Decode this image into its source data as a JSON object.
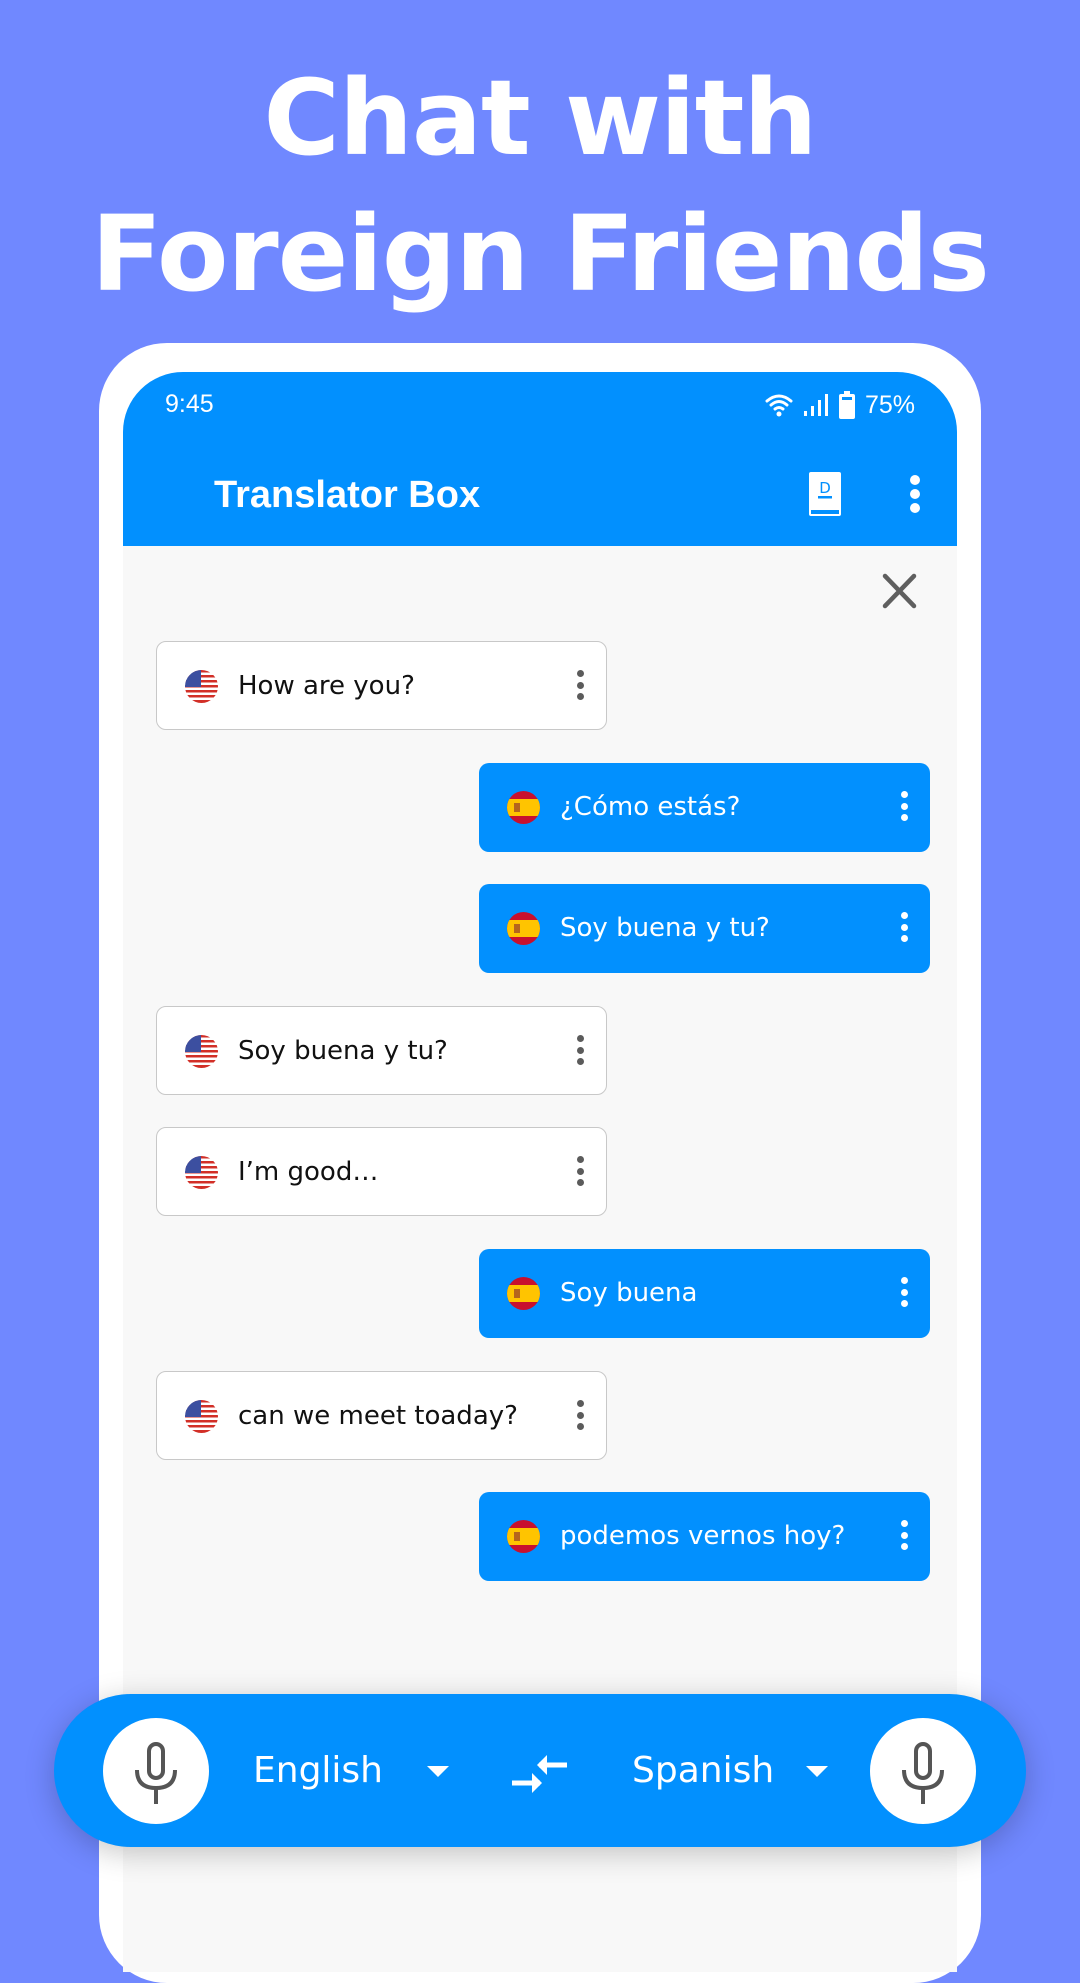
{
  "headline": {
    "line1": "Chat with",
    "line2": "Foreign Friends"
  },
  "status_bar": {
    "time": "9:45",
    "battery": "75%",
    "icons": [
      "wifi-icon",
      "signal-icon",
      "battery-icon"
    ]
  },
  "app_bar": {
    "title": "Translator Box",
    "actions": [
      "dictionary-icon",
      "more-vert-icon"
    ]
  },
  "colors": {
    "background": "#7088ff",
    "brand_blue": "#0290fe",
    "source_bubble": "#ffffff",
    "icon_gray": "#5b5b5b"
  },
  "conversation": {
    "close_icon": "close-icon",
    "messages": [
      {
        "side": "source",
        "lang_flag": "us-flag",
        "text": "How are you?"
      },
      {
        "side": "target",
        "lang_flag": "es-flag",
        "text": "¿Cómo estás?"
      },
      {
        "side": "target",
        "lang_flag": "es-flag",
        "text": "Soy buena y tu?"
      },
      {
        "side": "source",
        "lang_flag": "us-flag",
        "text": "Soy buena y tu?"
      },
      {
        "side": "source",
        "lang_flag": "us-flag",
        "text": "I’m good…"
      },
      {
        "side": "target",
        "lang_flag": "es-flag",
        "text": "Soy buena"
      },
      {
        "side": "source",
        "lang_flag": "us-flag",
        "text": "can we meet toaday?"
      },
      {
        "side": "target",
        "lang_flag": "es-flag",
        "text": "podemos vernos hoy?"
      }
    ]
  },
  "language_bar": {
    "source_language": "English",
    "target_language": "Spanish",
    "swap_icon": "swap-icon",
    "mic_icon": "mic-icon"
  }
}
